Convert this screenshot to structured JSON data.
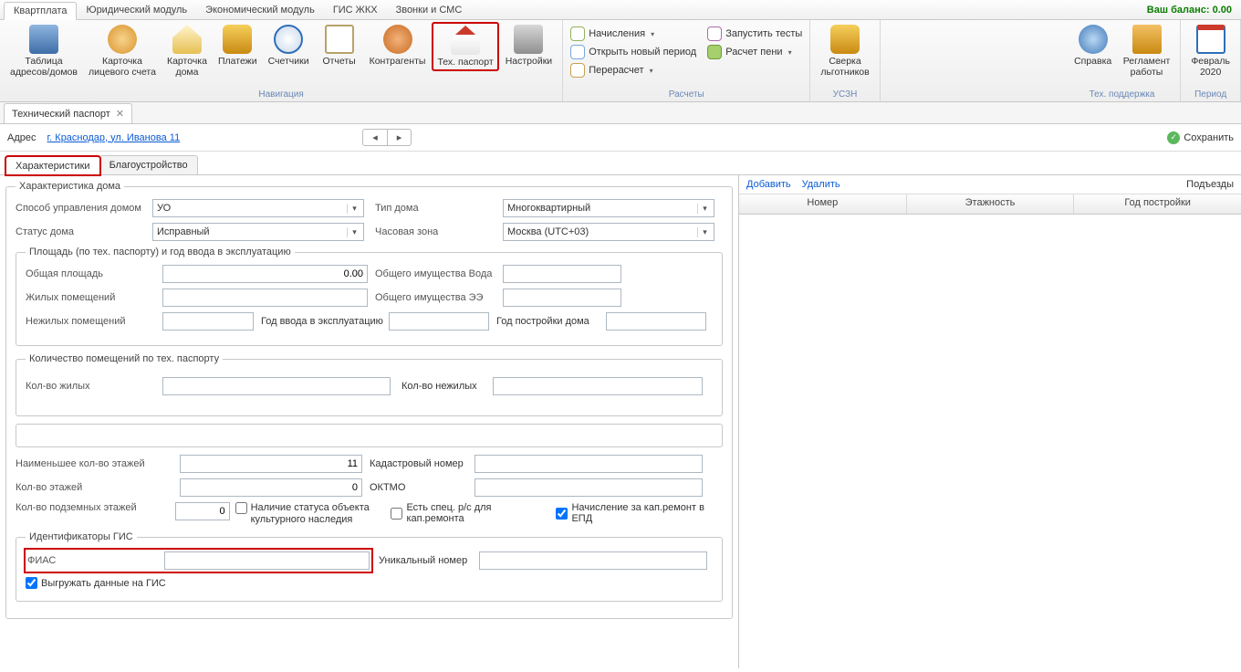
{
  "balance_label": "Ваш баланс: 0.00",
  "ribbon_tabs": [
    "Квартплата",
    "Юридический модуль",
    "Экономический модуль",
    "ГИС ЖКХ",
    "Звонки и СМС"
  ],
  "ribbon": {
    "nav": {
      "group_label": "Навигация",
      "buttons": [
        "Таблица\nадресов/домов",
        "Карточка\nлицевого счета",
        "Карточка\nдома",
        "Платежи",
        "Счетчики",
        "Отчеты",
        "Контрагенты",
        "Тех. паспорт",
        "Настройки"
      ]
    },
    "calc": {
      "group_label": "Расчеты",
      "items": [
        "Начисления",
        "Открыть новый период",
        "Перерасчет"
      ],
      "items2": [
        "Запустить тесты",
        "Расчет пени"
      ]
    },
    "uszn": {
      "group_label": "УСЗН",
      "button": "Сверка\nльготников"
    },
    "support": {
      "group_label": "Тех. поддержка",
      "buttons": [
        "Справка",
        "Регламент\nработы"
      ]
    },
    "period": {
      "group_label": "Период",
      "button": "Февраль\n2020"
    }
  },
  "doc_tab": "Технический паспорт",
  "addr_label": "Адрес",
  "addr_link": "г. Краснодар, ул. Иванова 11",
  "save_label": "Сохранить",
  "sub_tabs": [
    "Характеристики",
    "Благоустройство"
  ],
  "fs_main": "Характеристика дома",
  "row1": {
    "l1": "Способ управления домом",
    "v1": "УО",
    "l2": "Тип дома",
    "v2": "Многоквартирный"
  },
  "row2": {
    "l1": "Статус дома",
    "v1": "Исправный",
    "l2": "Часовая зона",
    "v2": "Москва (UTC+03)"
  },
  "fs_area": "Площадь (по тех. паспорту) и год ввода в эксплуатацию",
  "area": {
    "l_total": "Общая площадь",
    "v_total": "0.00",
    "l_living": "Жилых помещений",
    "l_nonliving": "Нежилых помещений",
    "l_common_water": "Общего имущества Вода",
    "l_common_ee": "Общего имущества ЭЭ",
    "l_year_enter": "Год ввода в эксплуатацию",
    "l_year_build": "Год постройки дома"
  },
  "fs_count": "Количество помещений по тех. паспорту",
  "count": {
    "l_living": "Кол-во жилых",
    "l_nonliving": "Кол-во нежилых"
  },
  "floors": {
    "l_min": "Наименьшее кол-во этажей",
    "v_min": "11",
    "l_cnt": "Кол-во этажей",
    "v_cnt": "0",
    "l_underground": "Кол-во подземных этажей",
    "v_underground": "0",
    "l_cadastral": "Кадастровый номер",
    "l_oktmo": "ОКТМО",
    "cb_heritage": "Наличие статуса объекта культурного наследия",
    "cb_spec": "Есть спец. р/с для кап.ремонта",
    "cb_epd": "Начисление за кап.ремонт в ЕПД"
  },
  "fs_gis": "Идентификаторы ГИС",
  "gis": {
    "l_fias": "ФИАС",
    "l_unique": "Уникальный номер",
    "cb_upload": "Выгружать данные на ГИС"
  },
  "right": {
    "add": "Добавить",
    "del": "Удалить",
    "title": "Подъезды",
    "cols": [
      "Номер",
      "Этажность",
      "Год постройки"
    ]
  }
}
